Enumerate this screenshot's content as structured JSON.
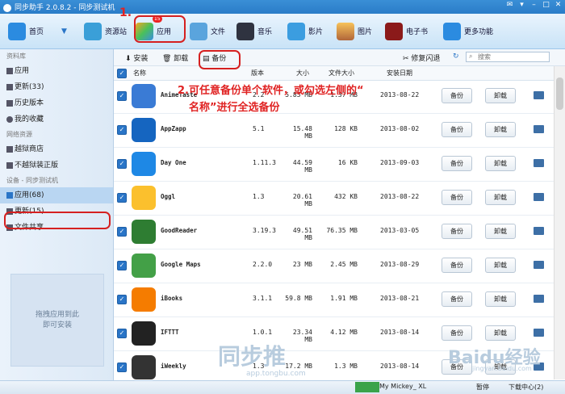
{
  "window": {
    "title": "同步助手 2.0.8.2 - 同步测试机"
  },
  "toolbar": {
    "items": [
      {
        "label": "首页",
        "icon": "home-icon"
      },
      {
        "label": "资源站",
        "icon": "shop-icon"
      },
      {
        "label": "应用",
        "icon": "apps-icon",
        "badge": "15"
      },
      {
        "label": "文件",
        "icon": "file-icon"
      },
      {
        "label": "音乐",
        "icon": "music-icon"
      },
      {
        "label": "影片",
        "icon": "video-icon"
      },
      {
        "label": "图片",
        "icon": "photo-icon"
      },
      {
        "label": "电子书",
        "icon": "ebook-icon"
      },
      {
        "label": "更多功能",
        "icon": "more-icon"
      }
    ]
  },
  "sidebar": {
    "section_lib": "资料库",
    "lib_items": [
      {
        "label": "应用"
      },
      {
        "label": "更新(33)"
      },
      {
        "label": "历史版本"
      },
      {
        "label": "我的收藏"
      }
    ],
    "section_net": "网络资源",
    "net_items": [
      {
        "label": "越狱商店"
      },
      {
        "label": "不越狱装正版"
      }
    ],
    "section_dev": "设备 - 同步测试机",
    "dev_items": [
      {
        "label": "应用(68)"
      },
      {
        "label": "更新(15)"
      },
      {
        "label": "文件共享"
      }
    ],
    "drop_hint_1": "拖拽应用到此",
    "drop_hint_2": "即可安装"
  },
  "actions": {
    "install": "安装",
    "uninstall": "卸载",
    "backup": "备份",
    "repair": "修复闪退",
    "search_placeholder": "搜索"
  },
  "table": {
    "headers": {
      "name": "名称",
      "version": "版本",
      "size": "大小",
      "doc_size": "文件大小",
      "date": "安装日期"
    },
    "rows": [
      {
        "name": "AnimeTaste",
        "version": "2.2",
        "size": "5.85 MB",
        "doc_size": "1.37 MB",
        "date": "2013-08-22"
      },
      {
        "name": "AppZapp",
        "version": "5.1",
        "size": "15.48 MB",
        "doc_size": "128 KB",
        "date": "2013-08-02"
      },
      {
        "name": "Day One",
        "version": "1.11.3",
        "size": "44.59 MB",
        "doc_size": "16 KB",
        "date": "2013-09-03"
      },
      {
        "name": "Oggl",
        "version": "1.3",
        "size": "20.61 MB",
        "doc_size": "432 KB",
        "date": "2013-08-22"
      },
      {
        "name": "GoodReader",
        "version": "3.19.3",
        "size": "49.51 MB",
        "doc_size": "76.35 MB",
        "date": "2013-03-05"
      },
      {
        "name": "Google Maps",
        "version": "2.2.0",
        "size": "23 MB",
        "doc_size": "2.45 MB",
        "date": "2013-08-29"
      },
      {
        "name": "iBooks",
        "version": "3.1.1",
        "size": "59.8 MB",
        "doc_size": "1.91 MB",
        "date": "2013-08-21"
      },
      {
        "name": "IFTTT",
        "version": "1.0.1",
        "size": "23.34 MB",
        "doc_size": "4.12 MB",
        "date": "2013-08-14"
      },
      {
        "name": "iWeekly",
        "version": "1.3",
        "size": "17.2 MB",
        "doc_size": "1.3 MB",
        "date": "2013-08-14"
      }
    ],
    "btn_backup": "备份",
    "btn_uninstall": "卸载"
  },
  "annotations": {
    "step1": "1.",
    "step2_line1": "2.可任意备份单个软件，或勾选左侧的“",
    "step2_line2": "名称”进行全选备份"
  },
  "statusbar": {
    "pause": "暂停",
    "task": "My Mickey_ XL",
    "download": "下载中心(2)"
  },
  "watermark": {
    "brand": "同步推",
    "url": "app.tongbu.com",
    "baidu": "Baidu经验",
    "jingyan": "jingyan.baidu.com"
  },
  "colors": {
    "accent": "#2a75c7",
    "annotation": "#e02323"
  }
}
